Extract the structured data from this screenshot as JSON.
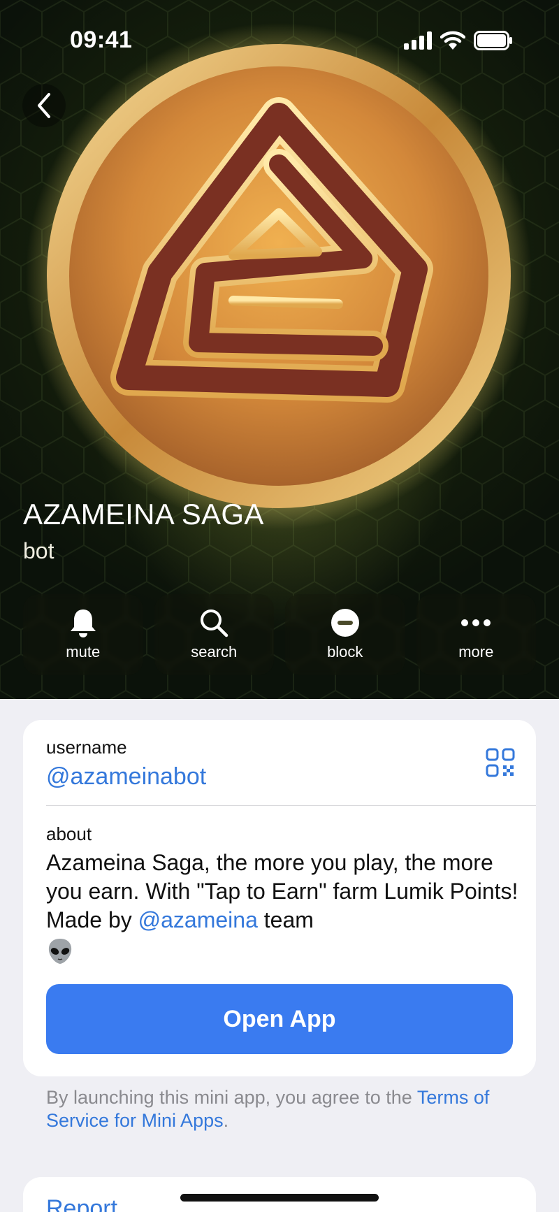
{
  "status_bar": {
    "time": "09:41",
    "icons": [
      "signal-icon",
      "wifi-icon",
      "battery-icon"
    ]
  },
  "header": {
    "back_icon": "chevron-left-icon"
  },
  "profile": {
    "name": "AZAMEINA SAGA",
    "subtitle": "bot"
  },
  "actions": [
    {
      "label": "mute",
      "icon": "bell-icon"
    },
    {
      "label": "search",
      "icon": "search-icon"
    },
    {
      "label": "block",
      "icon": "block-icon"
    },
    {
      "label": "more",
      "icon": "more-icon"
    }
  ],
  "info": {
    "username_label": "username",
    "username_value": "@azameinabot",
    "qr_icon": "qr-code-icon",
    "about_label": "about",
    "about_text_1": "Azameina Saga, the more you play, the more you earn. With \"Tap to Earn\" farm Lumik Points! Made by ",
    "about_link": "@azameina",
    "about_text_2": " team",
    "about_emoji": "alien-icon"
  },
  "open_app_label": "Open App",
  "terms": {
    "text": "By launching this mini app, you agree to the ",
    "link": "Terms of Service for Mini Apps",
    "suffix": "."
  },
  "report_label": "Report",
  "colors": {
    "accent": "#3478db",
    "button": "#3a7bf0",
    "background": "#efeff4",
    "hero_dark": "#0b120a",
    "coin_gold": "#d99a45"
  }
}
